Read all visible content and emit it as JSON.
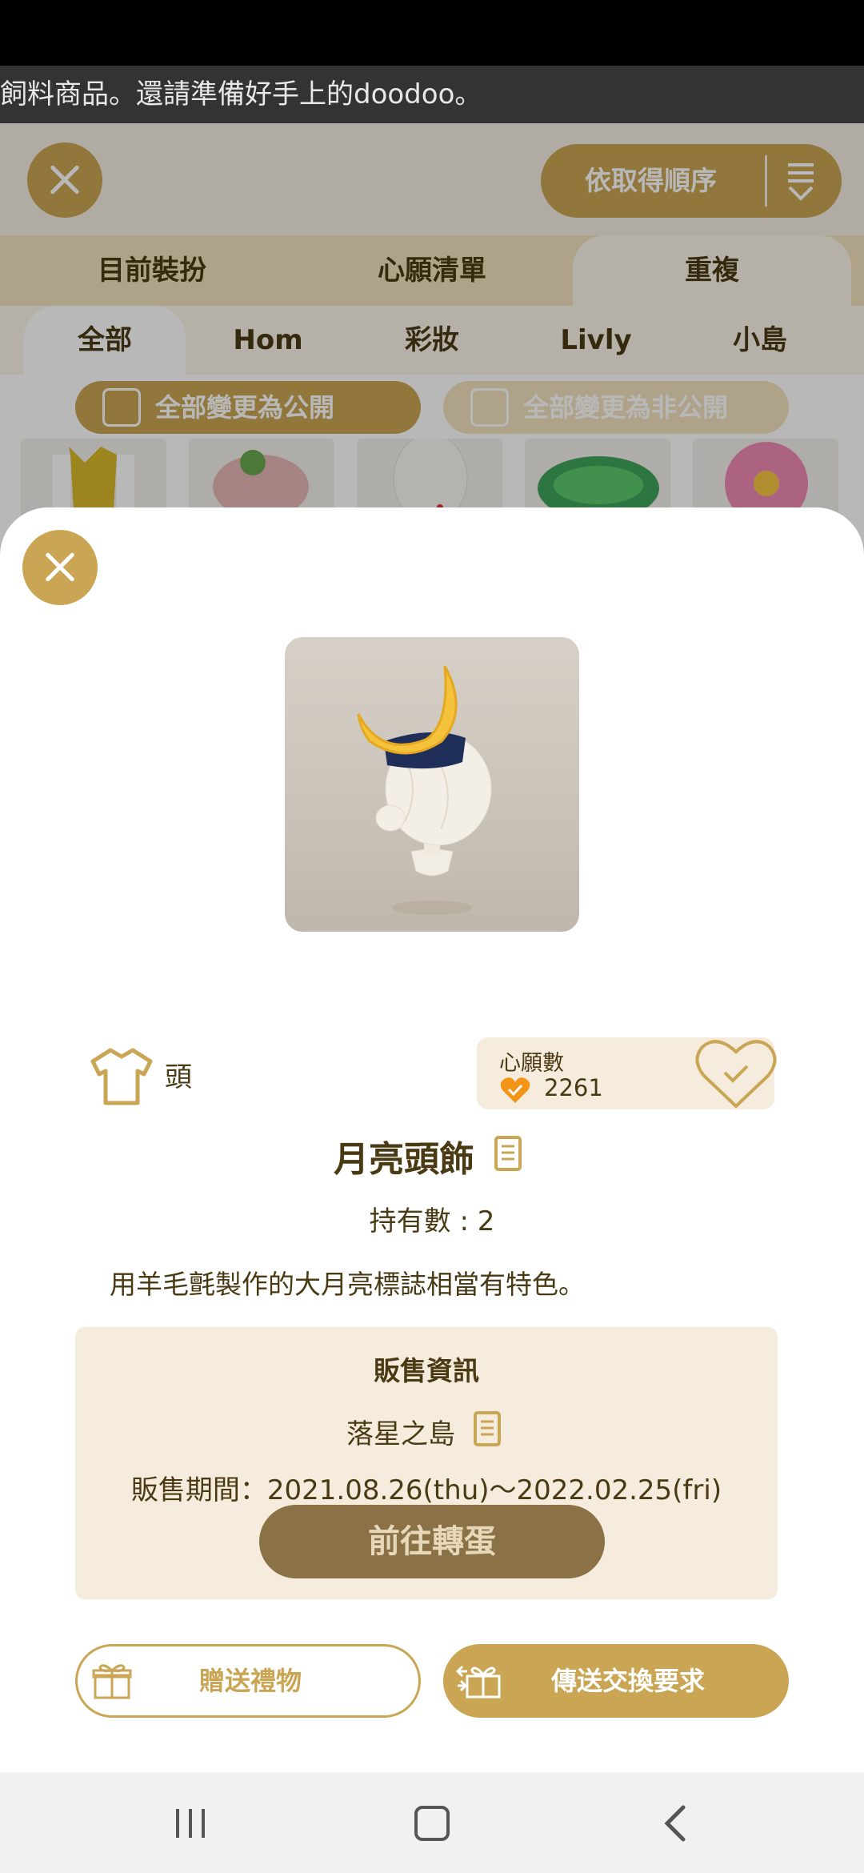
{
  "marquee": {
    "text": "飼料商品。還請準備好手上的doodoo。"
  },
  "background": {
    "sort": {
      "label": "依取得順序"
    },
    "tabs": [
      "目前裝扮",
      "心願清單",
      "重複"
    ],
    "active_tab": "重複",
    "subtabs": [
      "全部",
      "Hom",
      "彩妝",
      "Livly",
      "小島"
    ],
    "active_subtab": "全部",
    "make_public": "全部變更為公開",
    "make_private": "全部變更為非公開"
  },
  "item": {
    "category": "頭",
    "wish_title": "心願數",
    "wish_count": "2261",
    "name": "月亮頭飾",
    "owned": "持有數 : 2",
    "description": "用羊毛氈製作的大月亮標誌相當有特色。"
  },
  "sale": {
    "title": "販售資訊",
    "island": "落星之島",
    "period": "販售期間：2021.08.26(thu)～2022.02.25(fri)",
    "gacha_button": "前往轉蛋"
  },
  "actions": {
    "gift": "贈送禮物",
    "trade": "傳送交換要求"
  },
  "colors": {
    "accent_gold": "#c9a554",
    "disabled_brown": "#8a7246",
    "panel_beige": "#f5ecdd",
    "text_brown": "#4a3a14",
    "heart_orange": "#f29418"
  }
}
